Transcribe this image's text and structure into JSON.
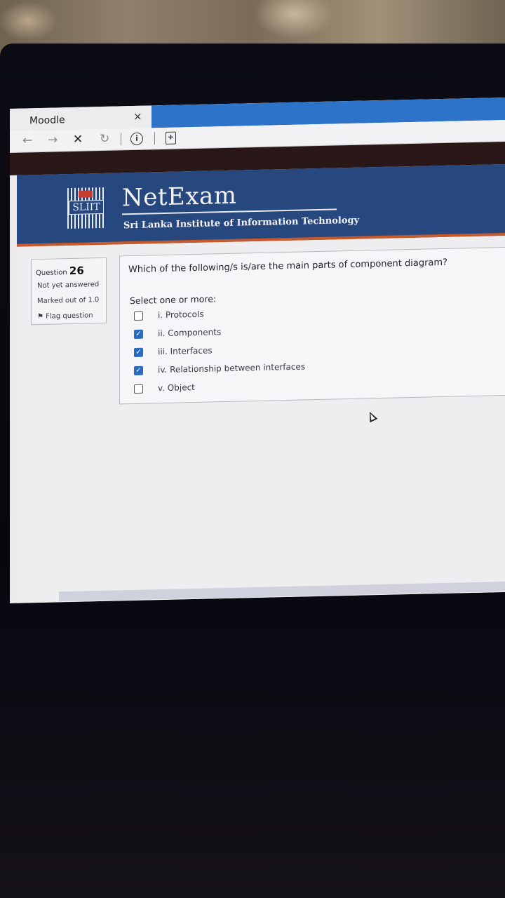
{
  "browser": {
    "tab_title": "Moodle",
    "tab_close": "×",
    "nav": {
      "back": "←",
      "forward": "→",
      "stop": "✕",
      "reload": "↻",
      "info": "i",
      "page": "+"
    }
  },
  "header": {
    "logo_text": "SLIIT",
    "brand": "NetExam",
    "subtitle": "Sri Lanka Institute of Information Technology"
  },
  "question_info": {
    "label": "Question",
    "number": "26",
    "status": "Not yet answered",
    "marks": "Marked out of 1.0",
    "flag_icon": "⚑",
    "flag_label": "Flag question"
  },
  "question": {
    "text": "Which of the following/s is/are the main parts of component diagram?",
    "prompt": "Select one or more:",
    "options": [
      {
        "label": "i. Protocols",
        "checked": false
      },
      {
        "label": "ii. Components",
        "checked": true
      },
      {
        "label": "iii. Interfaces",
        "checked": true
      },
      {
        "label": "iv. Relationship between interfaces",
        "checked": true
      },
      {
        "label": "v. Object",
        "checked": false
      }
    ]
  },
  "colors": {
    "header_blue": "#26487f",
    "accent_orange": "#c75a2a",
    "checkbox_blue": "#2a6bc2",
    "tab_blue": "#2c73c9"
  }
}
